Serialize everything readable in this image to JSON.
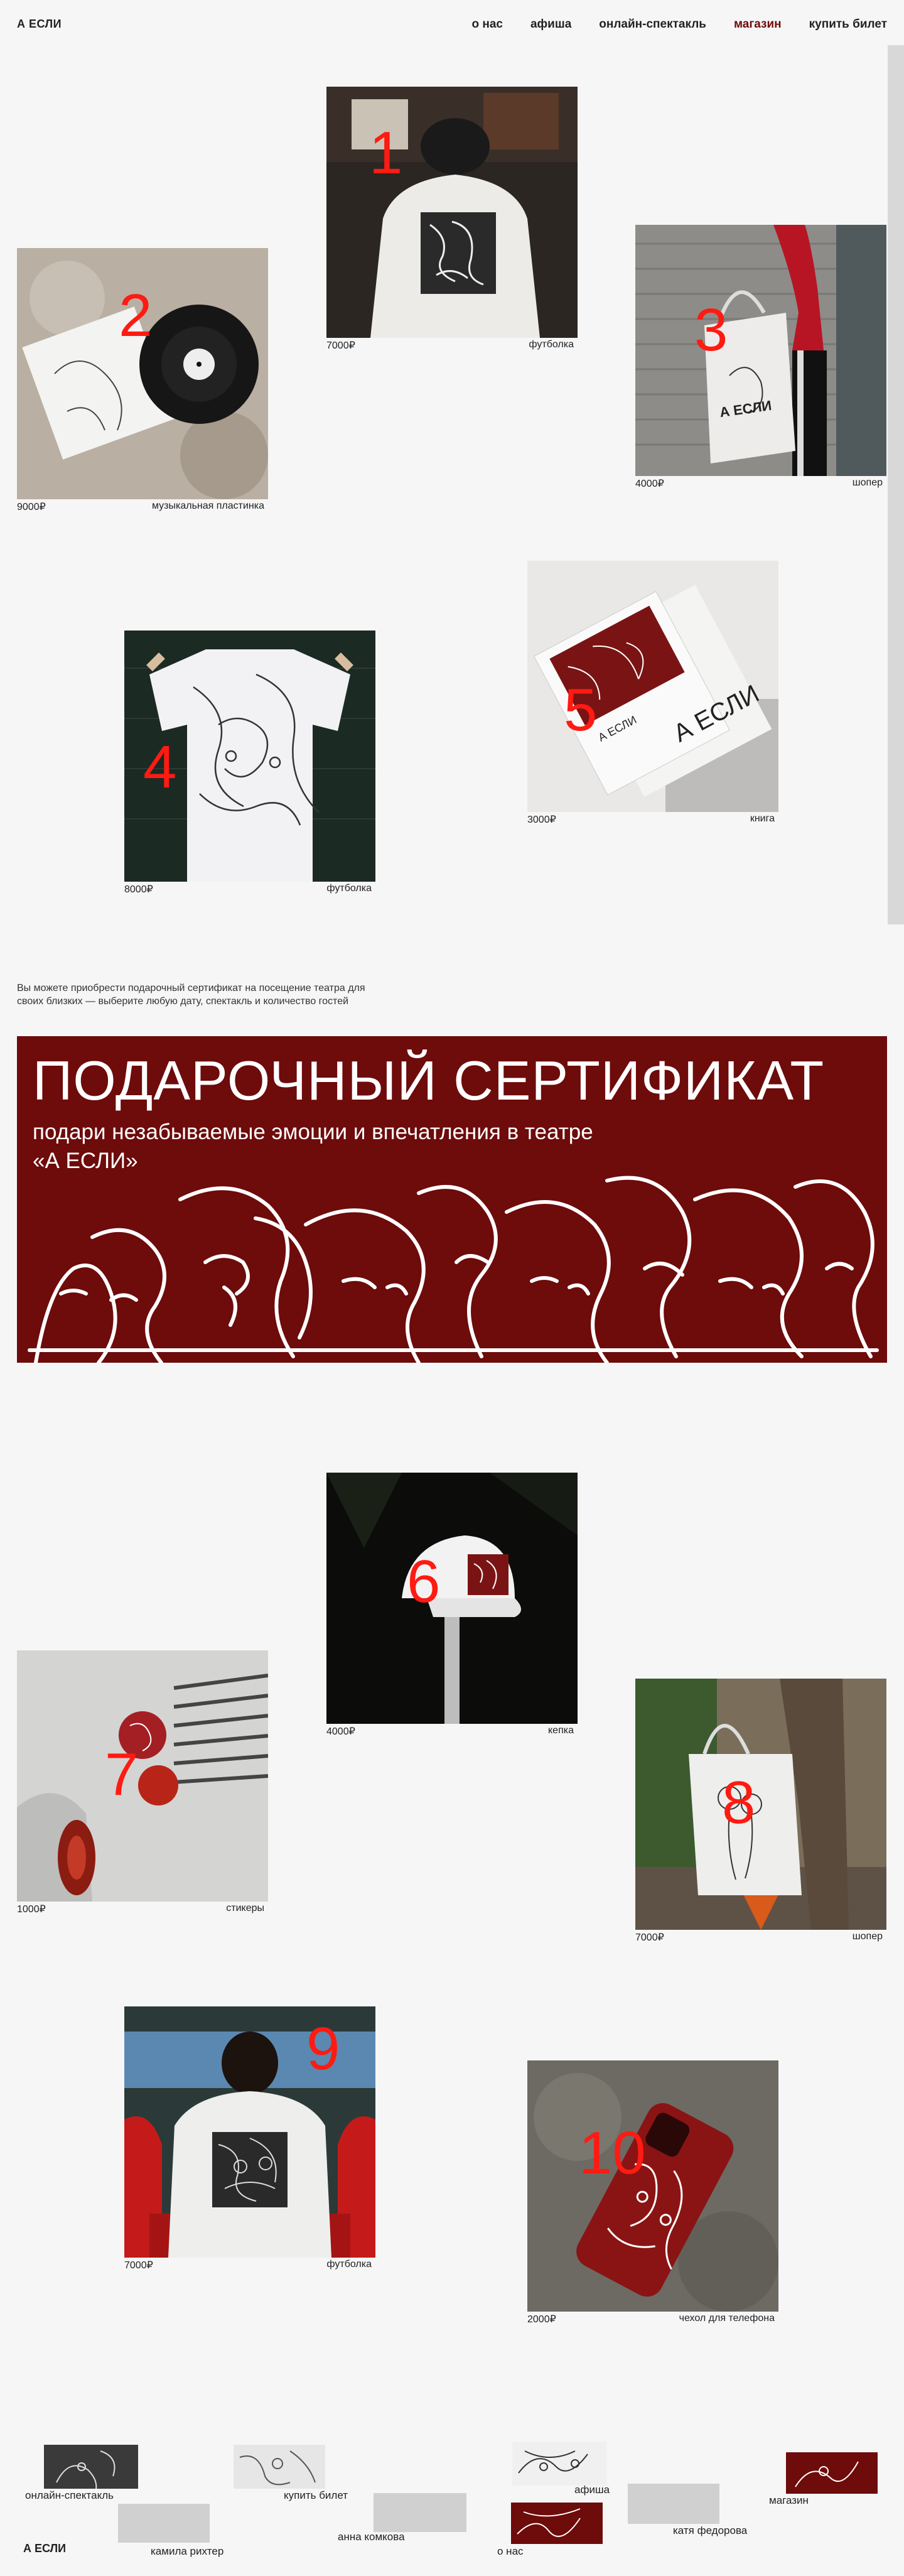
{
  "header": {
    "logo": "А ЕСЛИ",
    "nav": [
      "о нас",
      "афиша",
      "онлайн-спектакль",
      "магазин",
      "купить билет"
    ],
    "active_nav": "магазин"
  },
  "products": [
    {
      "num": "1",
      "price": "7000₽",
      "name": "футболка"
    },
    {
      "num": "2",
      "price": "9000₽",
      "name": "музыкальная пластинка"
    },
    {
      "num": "3",
      "price": "4000₽",
      "name": "шопер"
    },
    {
      "num": "4",
      "price": "8000₽",
      "name": "футболка"
    },
    {
      "num": "5",
      "price": "3000₽",
      "name": "книга"
    },
    {
      "num": "6",
      "price": "4000₽",
      "name": "кепка"
    },
    {
      "num": "7",
      "price": "1000₽",
      "name": "стикеры"
    },
    {
      "num": "8",
      "price": "7000₽",
      "name": "шопер"
    },
    {
      "num": "9",
      "price": "7000₽",
      "name": "футболка"
    },
    {
      "num": "10",
      "price": "2000₽",
      "name": "чехол для телефона"
    }
  ],
  "certificate": {
    "intro": "Вы можете приобрести подарочный сертификат на посещение театра для своих близких — выберите любую дату, спектакль и количество гостей",
    "title": "ПОДАРОЧНЫЙ СЕРТИФИКАТ",
    "subtitle": "подари незабываемые эмоции и впечатления в театре «А ЕСЛИ»"
  },
  "footer": {
    "logo": "А ЕСЛИ",
    "links": [
      "онлайн-спектакль",
      "купить билет",
      "афиша",
      "магазин",
      "камила рихтер",
      "анна комкова",
      "катя федорова",
      "о нас"
    ]
  },
  "colors": {
    "accent": "#6e0b0b",
    "number": "#ff1a12",
    "background": "#f6f6f6"
  }
}
